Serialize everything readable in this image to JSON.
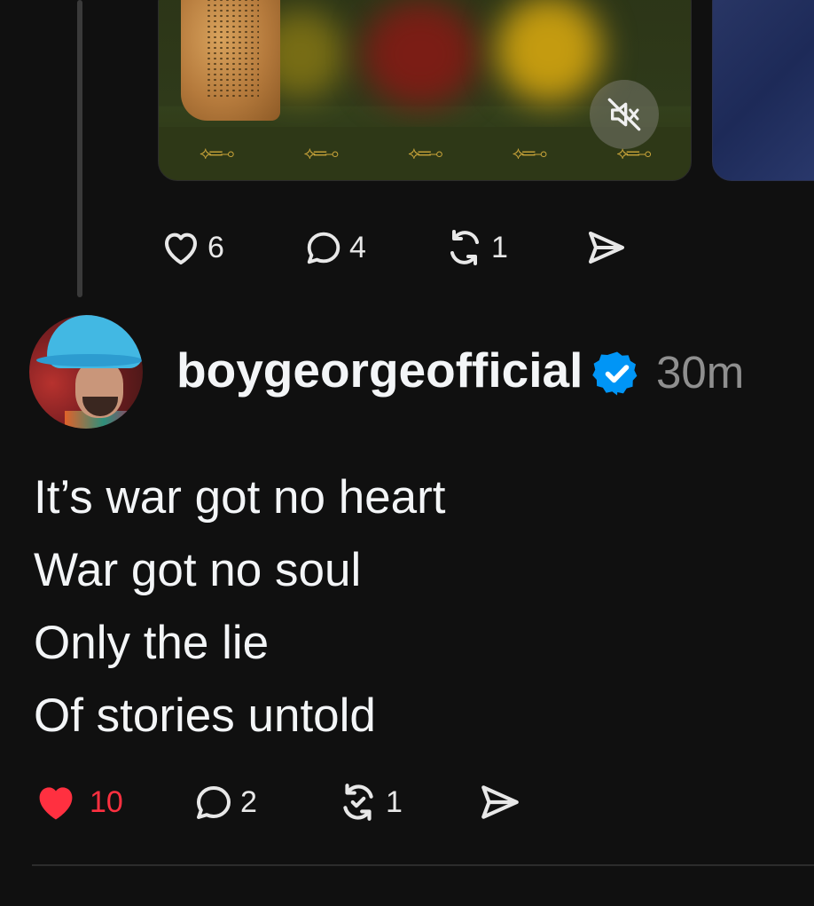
{
  "previous_post": {
    "like_count": "6",
    "reply_count": "4",
    "repost_count": "1",
    "mute_icon": "volume-mute-icon"
  },
  "post": {
    "username": "boygeorgeofficial",
    "verified_icon": "verified-badge-icon",
    "timestamp": "30m",
    "lines": [
      "It’s war got no heart",
      "War got no soul",
      "Only the lie",
      "Of stories untold"
    ],
    "like_count": "10",
    "liked": true,
    "reply_count": "2",
    "repost_count": "1"
  },
  "colors": {
    "background": "#101010",
    "text": "#f3f5f7",
    "muted": "#8f8f8f",
    "liked": "#ff3040",
    "verified": "#0095f6"
  }
}
